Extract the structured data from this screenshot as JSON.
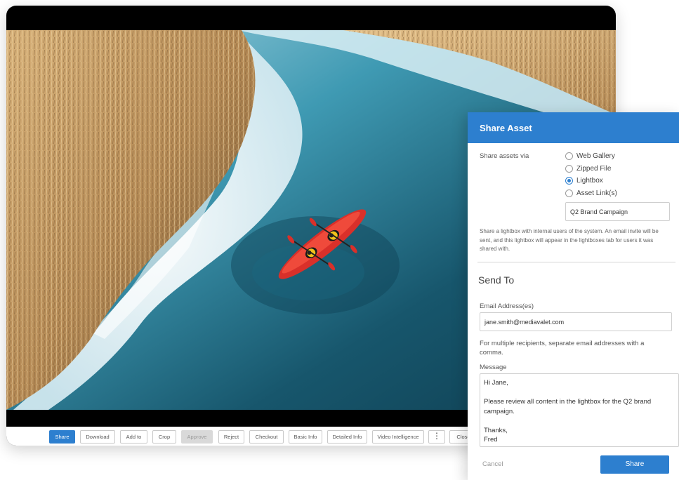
{
  "toolbar": {
    "buttons": [
      "Share",
      "Download",
      "Add to",
      "Crop",
      "Approve",
      "Reject",
      "Checkout",
      "Basic Info",
      "Detailed Info",
      "Video Intelligence",
      "⋮",
      "Close"
    ]
  },
  "share_panel": {
    "title": "Share Asset",
    "share_via_label": "Share assets via",
    "options": [
      "Web Gallery",
      "Zipped File",
      "Lightbox",
      "Asset Link(s)"
    ],
    "selected_option": "Lightbox",
    "lightbox_name": "Q2 Brand Campaign",
    "description": "Share a lightbox with internal users of the system. An email invite will be sent, and this lightbox will appear in the lightboxes tab for users it was shared with.",
    "send_to_title": "Send To",
    "email_label": "Email Address(es)",
    "email_value": "jane.smith@mediavalet.com",
    "email_hint": "For multiple recipients, separate email addresses with a comma.",
    "message_label": "Message",
    "message_value": "Hi Jane,\n\nPlease review all content in the lightbox for the Q2 brand campaign.\n\nThanks,\nFred",
    "cancel_label": "Cancel",
    "share_label": "Share"
  },
  "colors": {
    "accent": "#2d7fcf",
    "water": "#1d5f76",
    "reeds": "#c49a62",
    "kayak": "#d9302a"
  }
}
